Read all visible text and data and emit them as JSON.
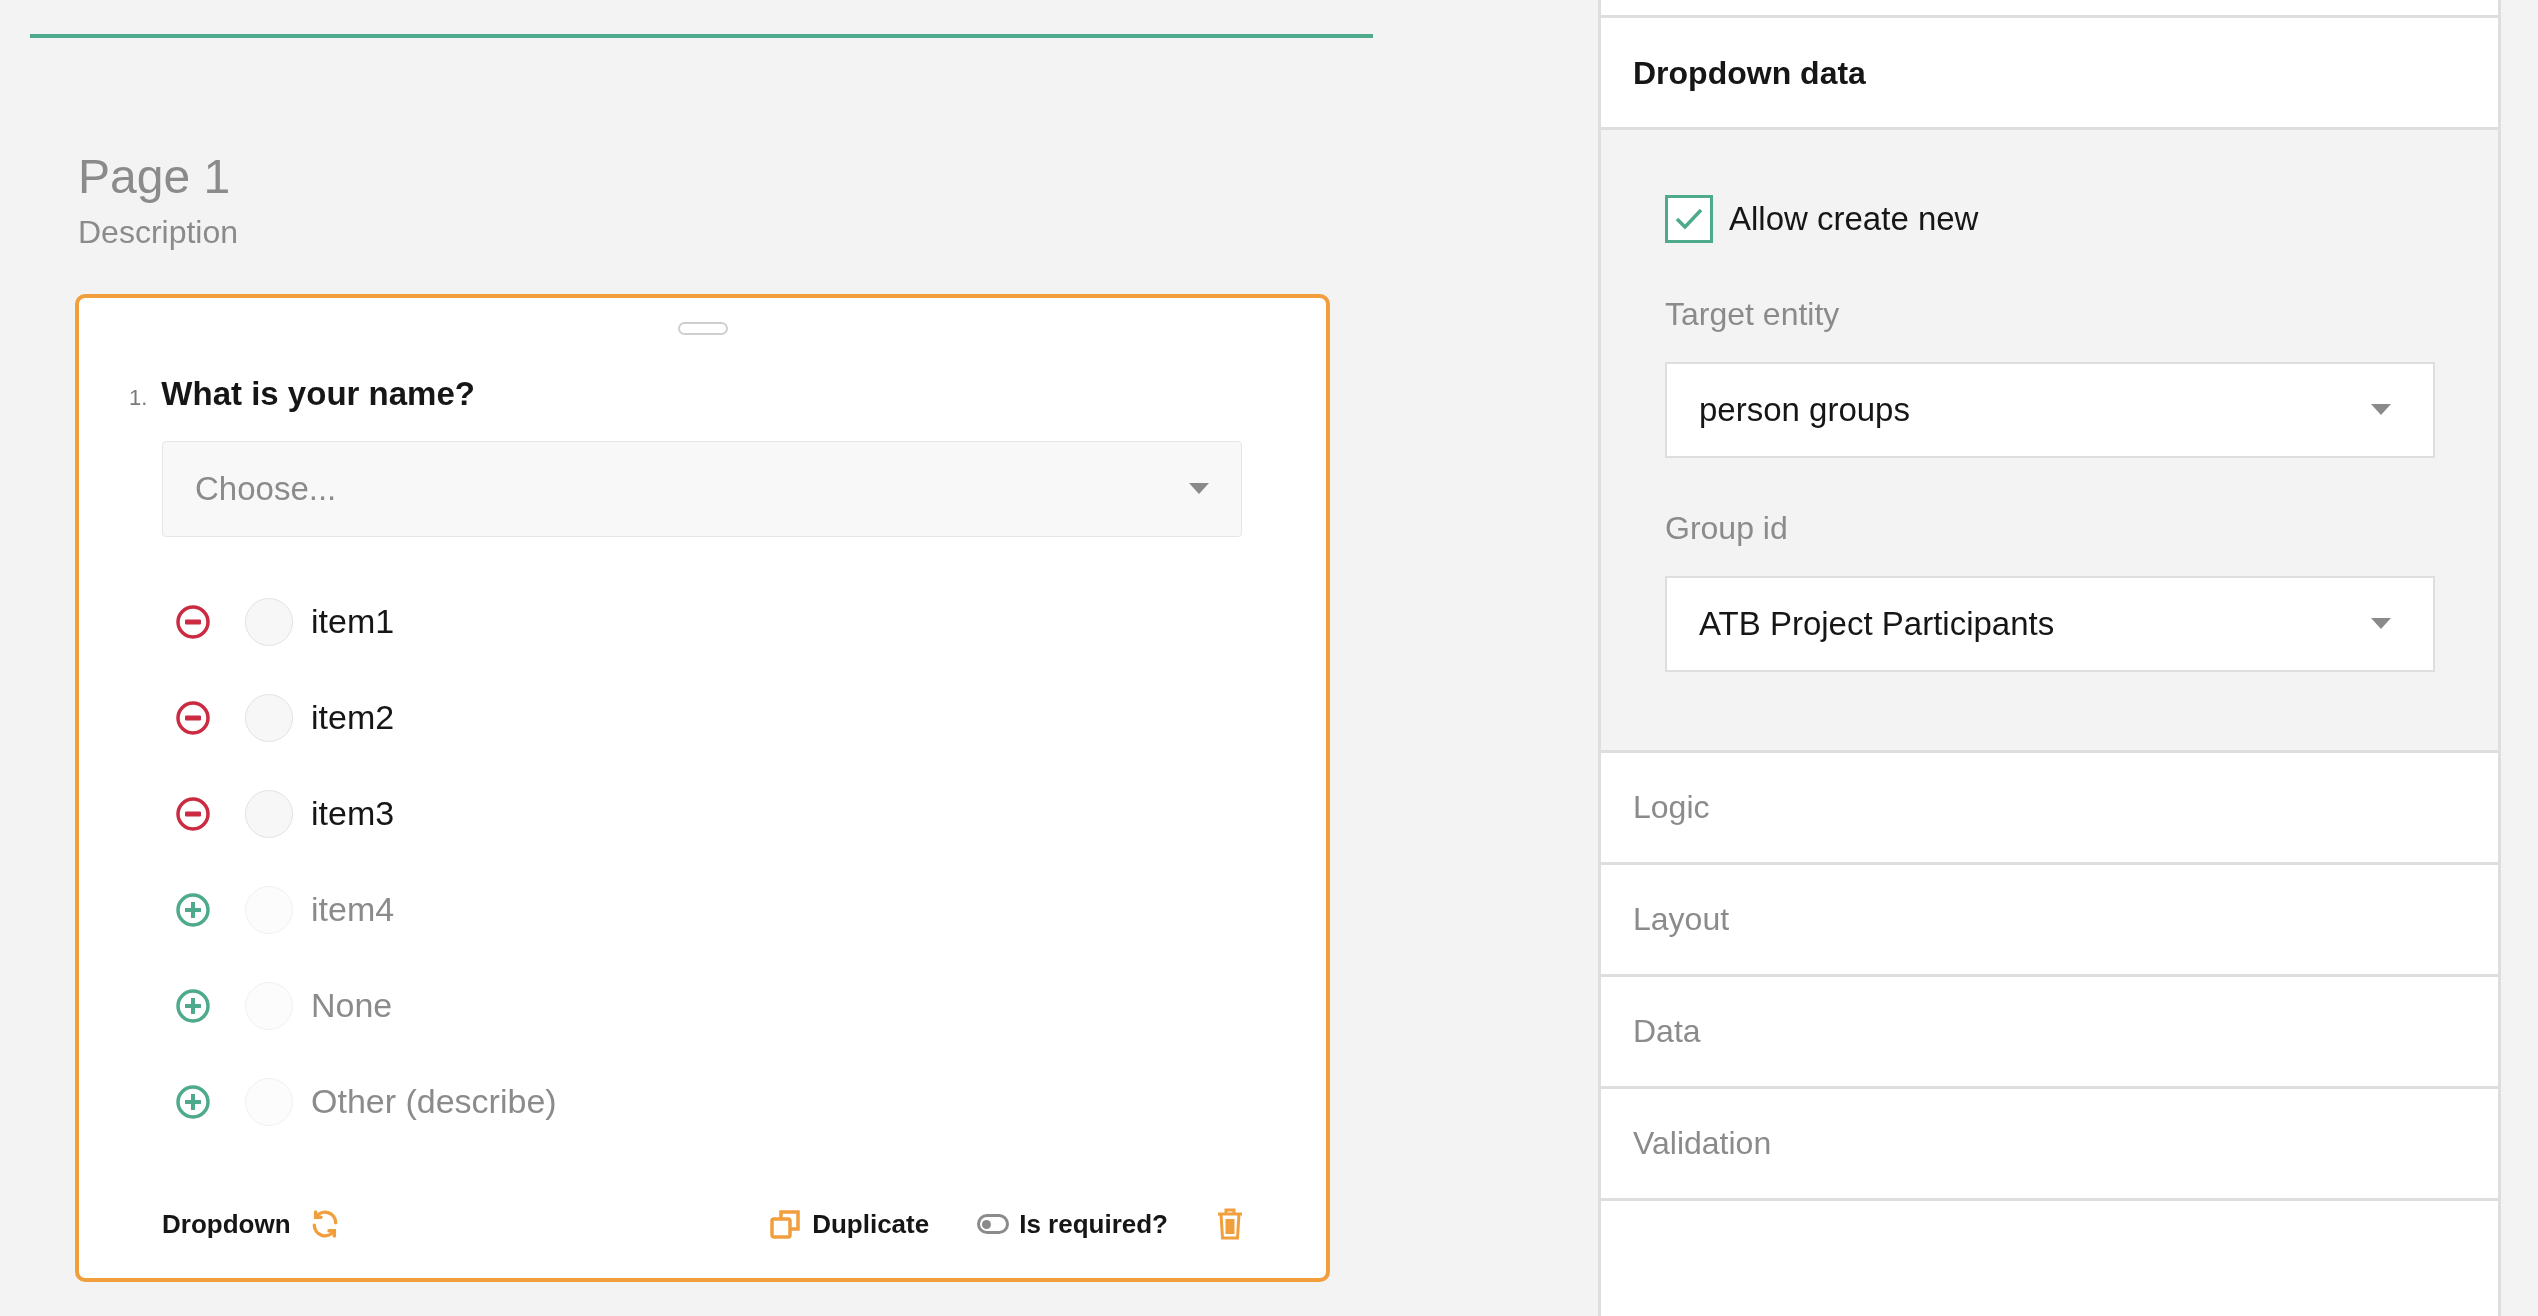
{
  "page": {
    "title": "Page 1",
    "description": "Description"
  },
  "question": {
    "number": "1.",
    "title": "What is your name?",
    "placeholder": "Choose...",
    "choices": [
      {
        "label": "item1",
        "kind": "remove",
        "selected": false
      },
      {
        "label": "item2",
        "kind": "remove",
        "selected": false
      },
      {
        "label": "item3",
        "kind": "remove",
        "selected": false
      },
      {
        "label": "item4",
        "kind": "add",
        "selected": false
      },
      {
        "label": "None",
        "kind": "add",
        "selected": false
      },
      {
        "label": "Other (describe)",
        "kind": "add",
        "selected": false
      }
    ],
    "footer": {
      "type_label": "Dropdown",
      "duplicate": "Duplicate",
      "required": {
        "label": "Is required?",
        "on": false
      }
    }
  },
  "properties": {
    "header": "Dropdown data",
    "allow_create_new": {
      "label": "Allow create new",
      "checked": true
    },
    "fields": [
      {
        "label": "Target entity",
        "value": "person groups"
      },
      {
        "label": "Group id",
        "value": "ATB Project Participants"
      }
    ],
    "sections": [
      {
        "title": "Logic"
      },
      {
        "title": "Layout"
      },
      {
        "title": "Data"
      },
      {
        "title": "Validation"
      }
    ]
  }
}
